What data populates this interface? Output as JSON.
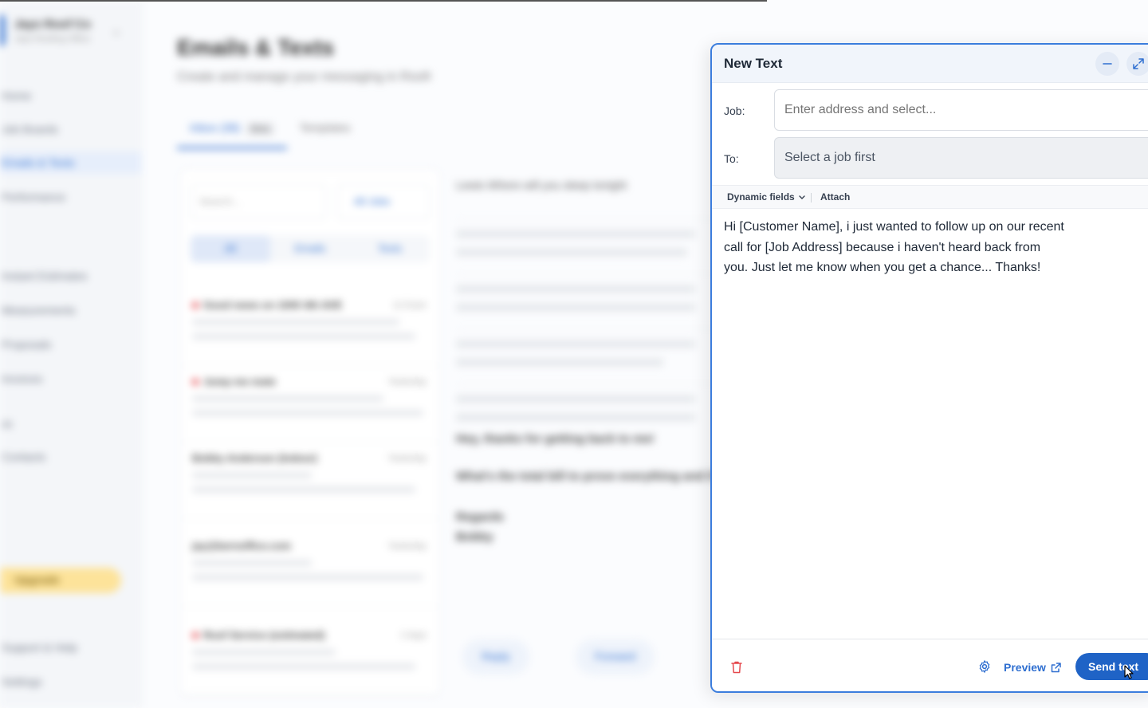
{
  "background": {
    "brand_name": "Jays Roof Co",
    "brand_sub": "Jays Roofing Office",
    "nav": [
      "Home",
      "Job Boards",
      "Emails & Texts",
      "Performance",
      "Instant Estimates",
      "Measurements",
      "Proposals",
      "Invoices",
      "AI",
      "Contacts"
    ],
    "upgrade_label": "Upgrade",
    "footer_nav": [
      "Support & Help",
      "Settings"
    ],
    "page_title": "Emails & Texts",
    "page_subtitle": "Create and manage your messaging in Roofr",
    "tabs": [
      {
        "label": "Inbox (38)",
        "badge": "Beta"
      },
      {
        "label": "Templates"
      }
    ],
    "search_placeholder": "Search...",
    "filter_label": "All Jobs",
    "segments": [
      "All",
      "Emails",
      "Texts"
    ],
    "messages": [
      {
        "title": "Good news on 1000 4th AVE",
        "time": "11:51am"
      },
      {
        "title": "Jump me mate",
        "time": "Yesterday"
      },
      {
        "title": "Bobby Anderson (Indoor)",
        "time": "Yesterday"
      },
      {
        "title": "jay@bernoffice.com",
        "time": "Yesterday"
      },
      {
        "title": "Roof Service (estimated)",
        "time": "2 days"
      }
    ],
    "thread_heading": "Lewis  Where will you sleep tonight",
    "thread_lines": [
      "Hey, thanks for getting back to me!",
      "What's the total bill to prove everything and if",
      "Regards",
      "Bobby"
    ],
    "reply_label": "Reply",
    "forward_label": "Forward"
  },
  "modal": {
    "title": "New Text",
    "minimize_icon": "minus-icon",
    "expand_icon": "expand-icon",
    "job_label": "Job:",
    "job_placeholder": "Enter address and select...",
    "to_label": "To:",
    "to_value": "Select a job first",
    "dynamic_fields_label": "Dynamic fields",
    "attach_label": "Attach",
    "message": "Hi [Customer Name], i just wanted to follow up on our recent call for [Job Address] because i haven't heard back from you. Just let me know when you get a chance... Thanks!",
    "preview_label": "Preview",
    "send_label": "Send text",
    "colors": {
      "accent": "#1f63c6",
      "border": "#3b7ddd",
      "danger": "#e5484d"
    }
  }
}
